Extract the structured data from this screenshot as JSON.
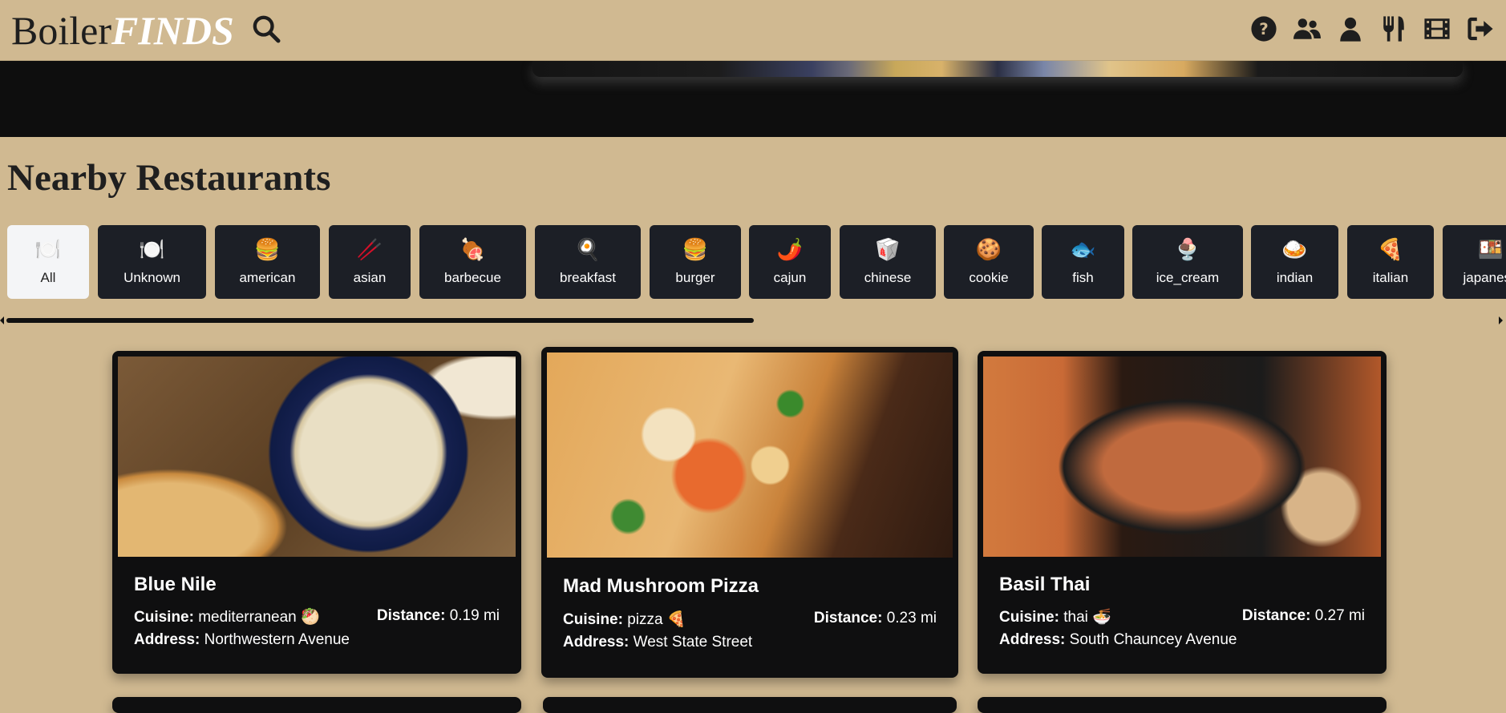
{
  "app": {
    "brand_prefix": "Boiler",
    "brand_suffix": "FINDS"
  },
  "nav": {
    "icons": [
      "help-icon",
      "friends-icon",
      "profile-icon",
      "restaurants-icon",
      "movies-icon",
      "logout-icon"
    ]
  },
  "section": {
    "title": "Nearby Restaurants"
  },
  "filters": [
    {
      "label": "All",
      "emoji": "🍽️",
      "active": true
    },
    {
      "label": "Unknown",
      "emoji": "🍽️"
    },
    {
      "label": "american",
      "emoji": "🍔"
    },
    {
      "label": "asian",
      "emoji": "🥢"
    },
    {
      "label": "barbecue",
      "emoji": "🍖"
    },
    {
      "label": "breakfast",
      "emoji": "🍳"
    },
    {
      "label": "burger",
      "emoji": "🍔"
    },
    {
      "label": "cajun",
      "emoji": "🌶️"
    },
    {
      "label": "chinese",
      "emoji": "🥡"
    },
    {
      "label": "cookie",
      "emoji": "🍪"
    },
    {
      "label": "fish",
      "emoji": "🐟"
    },
    {
      "label": "ice_cream",
      "emoji": "🍨"
    },
    {
      "label": "indian",
      "emoji": "🍛"
    },
    {
      "label": "italian",
      "emoji": "🍕"
    },
    {
      "label": "japanese",
      "emoji": "🍱"
    }
  ],
  "labels": {
    "cuisine": "Cuisine:",
    "distance": "Distance:",
    "address": "Address:"
  },
  "restaurants": [
    {
      "name": "Blue Nile",
      "cuisine": "mediterranean",
      "emoji": "🥙",
      "distance": "0.19 mi",
      "address": "Northwestern Avenue"
    },
    {
      "name": "Mad Mushroom Pizza",
      "cuisine": "pizza",
      "emoji": "🍕",
      "distance": "0.23 mi",
      "address": "West State Street"
    },
    {
      "name": "Basil Thai",
      "cuisine": "thai",
      "emoji": "🍜",
      "distance": "0.27 mi",
      "address": "South Chauncey Avenue"
    }
  ]
}
